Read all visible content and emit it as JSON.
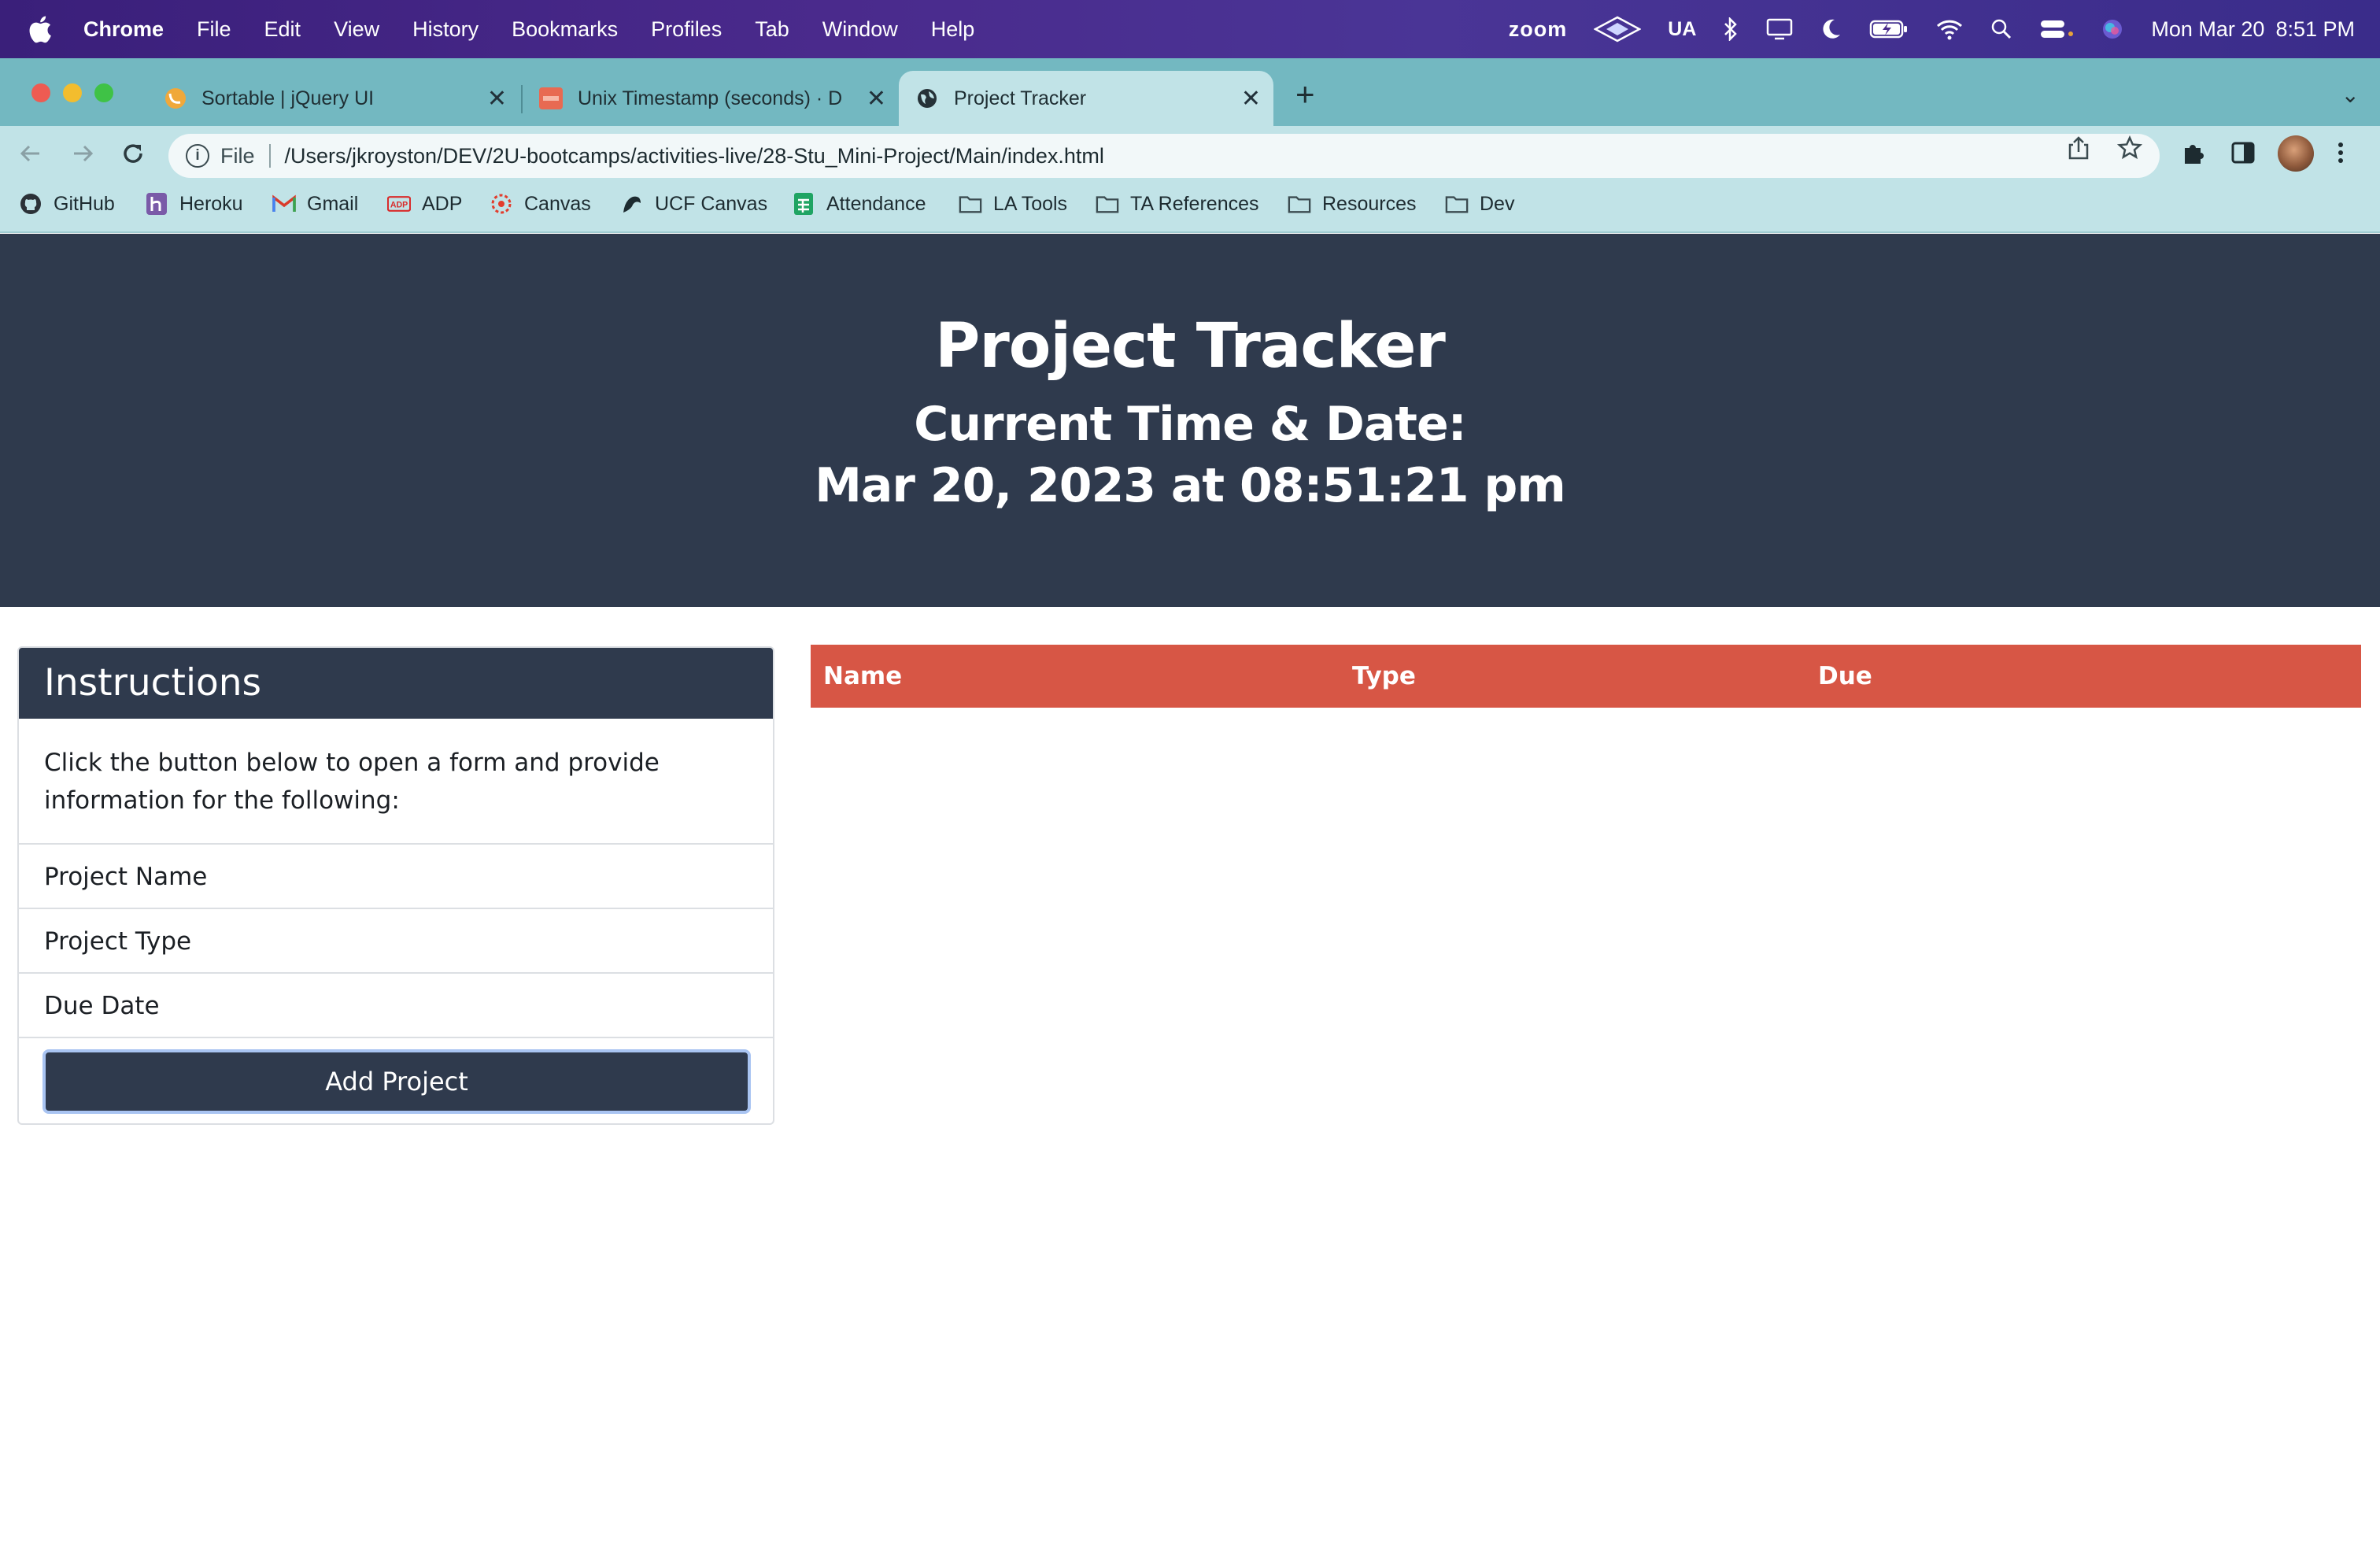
{
  "menubar": {
    "app_name": "Chrome",
    "items": [
      "File",
      "Edit",
      "View",
      "History",
      "Bookmarks",
      "Profiles",
      "Tab",
      "Window",
      "Help"
    ],
    "status": {
      "zoom": "zoom",
      "ua": "UA",
      "date": "Mon Mar 20",
      "time": "8:51 PM"
    }
  },
  "tabs": [
    {
      "title": "Sortable | jQuery UI",
      "icon": "jquery-favicon"
    },
    {
      "title": "Unix Timestamp (seconds) · D",
      "icon": "dayjs-favicon"
    },
    {
      "title": "Project Tracker",
      "icon": "globe-icon",
      "active": true
    }
  ],
  "omnibox": {
    "scheme": "File",
    "url": "/Users/jkroyston/DEV/2U-bootcamps/activities-live/28-Stu_Mini-Project/Main/index.html"
  },
  "bookmarks": [
    "GitHub",
    "Heroku",
    "Gmail",
    "ADP",
    "Canvas",
    "UCF Canvas",
    "Attendance",
    "LA Tools",
    "TA References",
    "Resources",
    "Dev"
  ],
  "page": {
    "title": "Project Tracker",
    "subtitle": "Current Time & Date:",
    "datetime": "Mar 20, 2023 at 08:51:21 pm",
    "instructions": {
      "header": "Instructions",
      "body": "Click the button below to open a form and provide information for the following:",
      "items": [
        "Project Name",
        "Project Type",
        "Due Date"
      ],
      "button": "Add Project"
    },
    "table": {
      "columns": [
        "Name",
        "Type",
        "Due"
      ]
    }
  },
  "colors": {
    "hero_bg": "#2f3a4d",
    "table_head": "#d75645",
    "chrome_frame": "#73b8c1",
    "toolbar": "#c1e3e7"
  }
}
